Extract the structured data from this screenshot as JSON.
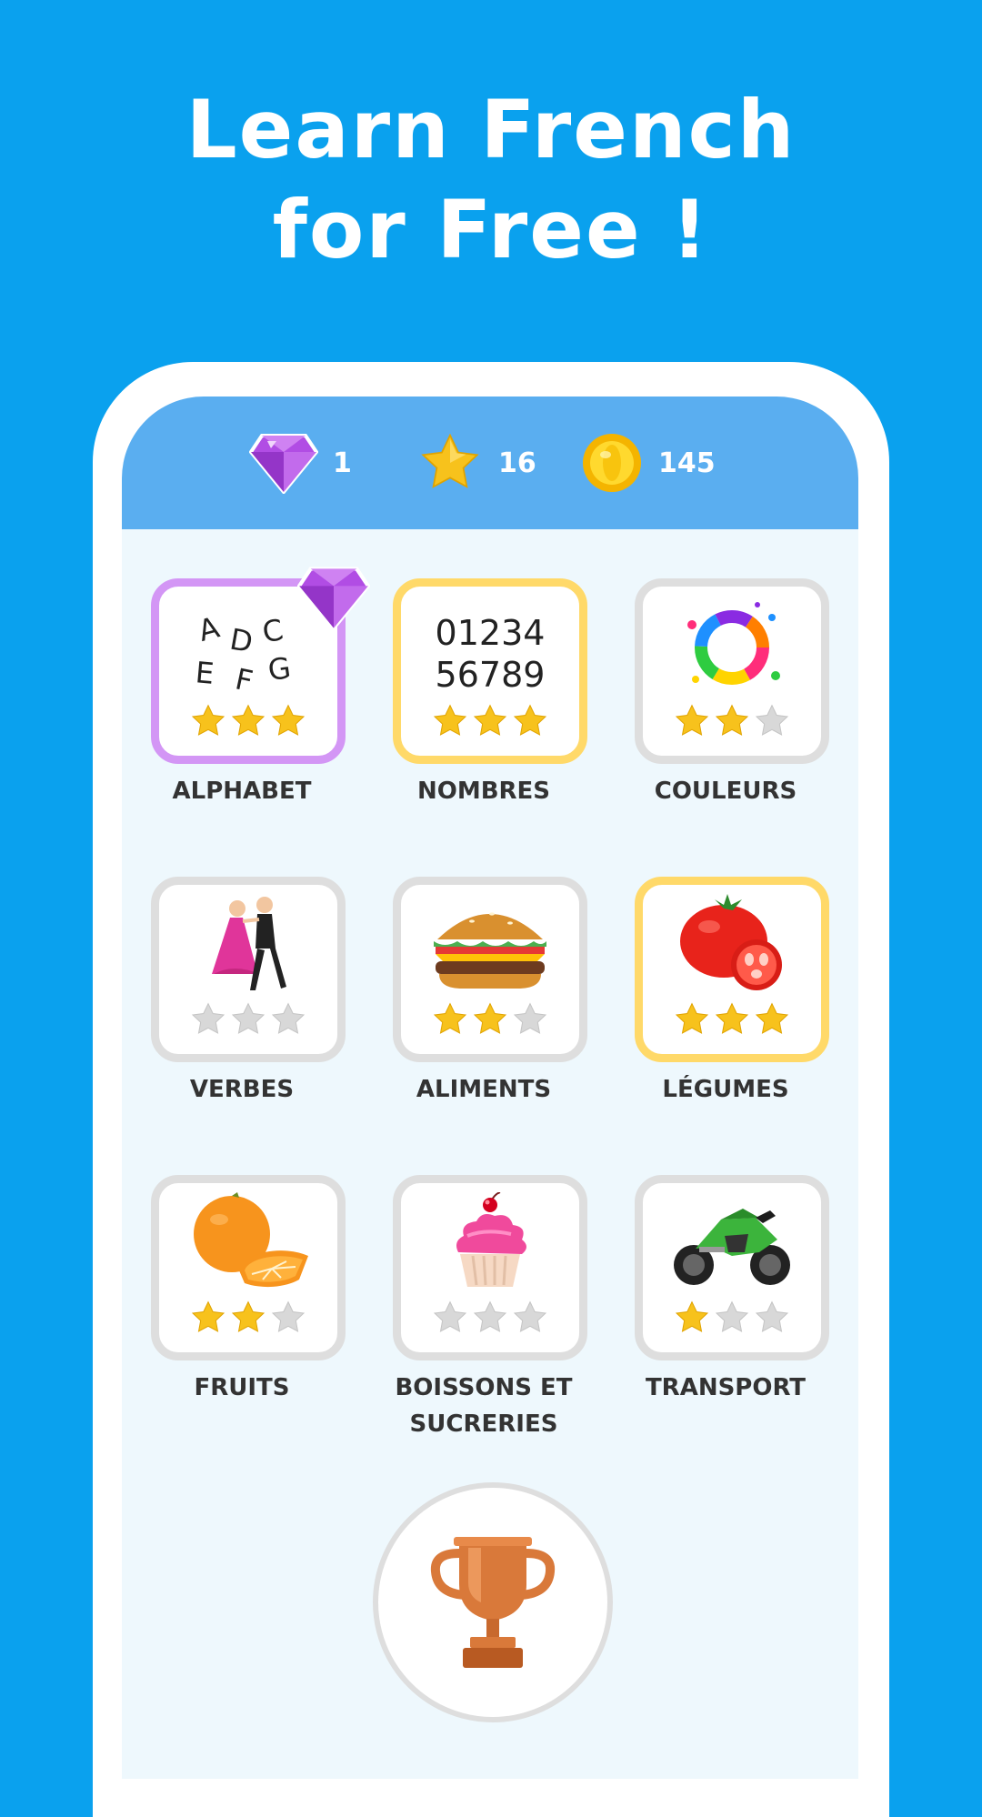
{
  "headline": {
    "line1": "Learn French",
    "line2": "for Free !"
  },
  "stats": {
    "gems": "1",
    "stars": "16",
    "coins": "145"
  },
  "categories": [
    {
      "label": "ALPHABET",
      "stars": 3,
      "icon": "alphabet-letters-icon",
      "letters": [
        "A",
        "D",
        "C",
        "E",
        "F",
        "G"
      ]
    },
    {
      "label": "NOMBRES",
      "stars": 3,
      "icon": "numbers-icon",
      "digits_line1": "01234",
      "digits_line2": "56789"
    },
    {
      "label": "COULEURS",
      "stars": 2,
      "icon": "paint-splash-ring-icon"
    },
    {
      "label": "VERBES",
      "stars": 0,
      "icon": "dancing-couple-icon"
    },
    {
      "label": "ALIMENTS",
      "stars": 2,
      "icon": "burger-icon"
    },
    {
      "label": "LÉGUMES",
      "stars": 3,
      "icon": "tomato-icon"
    },
    {
      "label": "FRUITS",
      "stars": 2,
      "icon": "orange-icon"
    },
    {
      "label": "BOISSONS ET SUCRERIES",
      "label_line1": "BOISSONS ET",
      "label_line2": "SUCRERIES",
      "stars": 0,
      "icon": "cupcake-icon"
    },
    {
      "label": "TRANSPORT",
      "stars": 1,
      "icon": "motorcycle-icon"
    }
  ],
  "colors": {
    "background": "#0aa1ee",
    "topbar": "#5aaef0",
    "screen": "#eef8fd",
    "card_border_default": "#dedede",
    "card_border_gold": "#ffd969",
    "card_border_purple": "#d396f5",
    "star_gold": "#f7c21c",
    "star_empty": "#d8d8d8",
    "label_text": "#333333"
  },
  "trophy": {
    "icon": "trophy-icon"
  }
}
